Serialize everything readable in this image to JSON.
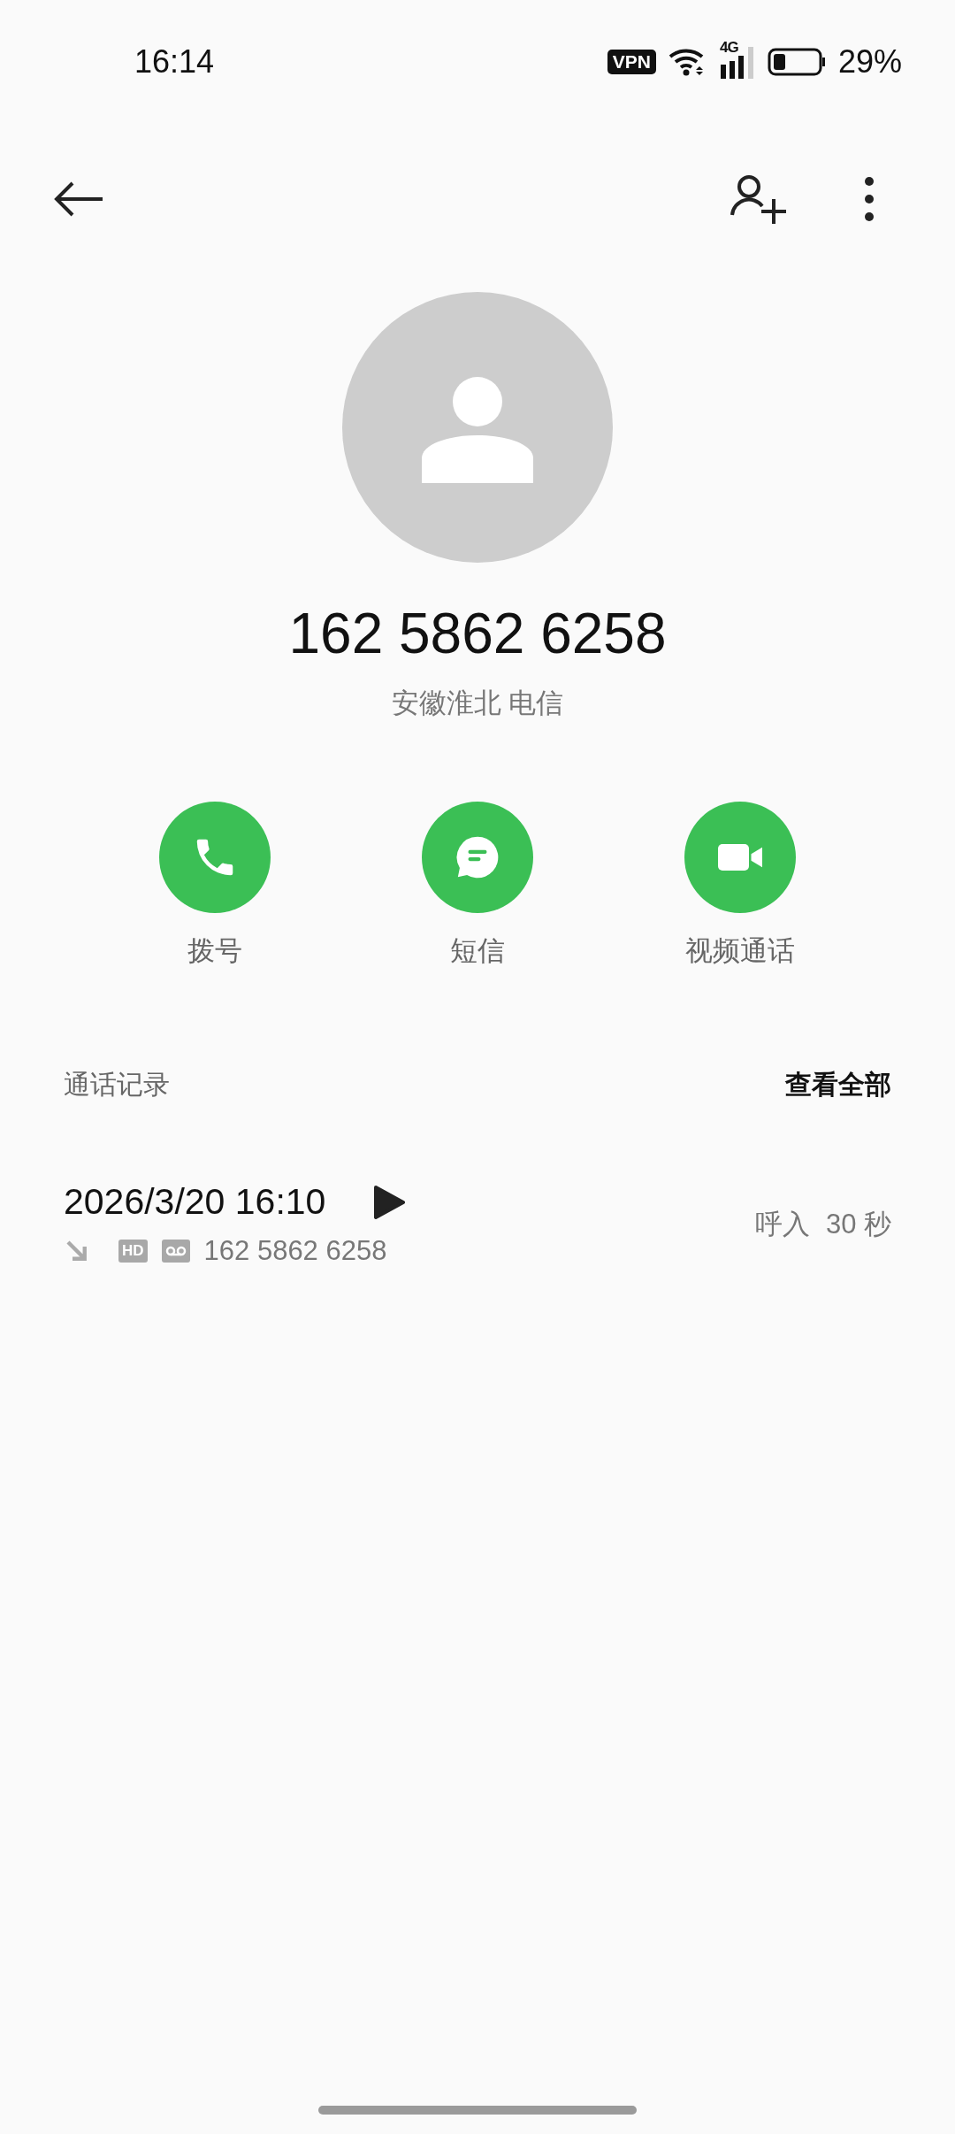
{
  "status_bar": {
    "time": "16:14",
    "vpn": "VPN",
    "network": "4G",
    "battery": "29%"
  },
  "contact": {
    "number": "162 5862 6258",
    "location": "安徽淮北 电信"
  },
  "actions": [
    {
      "kind": "call",
      "label": "拨号"
    },
    {
      "kind": "message",
      "label": "短信"
    },
    {
      "kind": "video",
      "label": "视频通话"
    }
  ],
  "call_log": {
    "title": "通话记录",
    "view_all": "查看全部",
    "entries": [
      {
        "datetime": "2026/3/20 16:10",
        "kind": "incoming",
        "hd": "HD",
        "number": "162 5862 6258",
        "type": "呼入",
        "duration": "30 秒"
      }
    ]
  }
}
